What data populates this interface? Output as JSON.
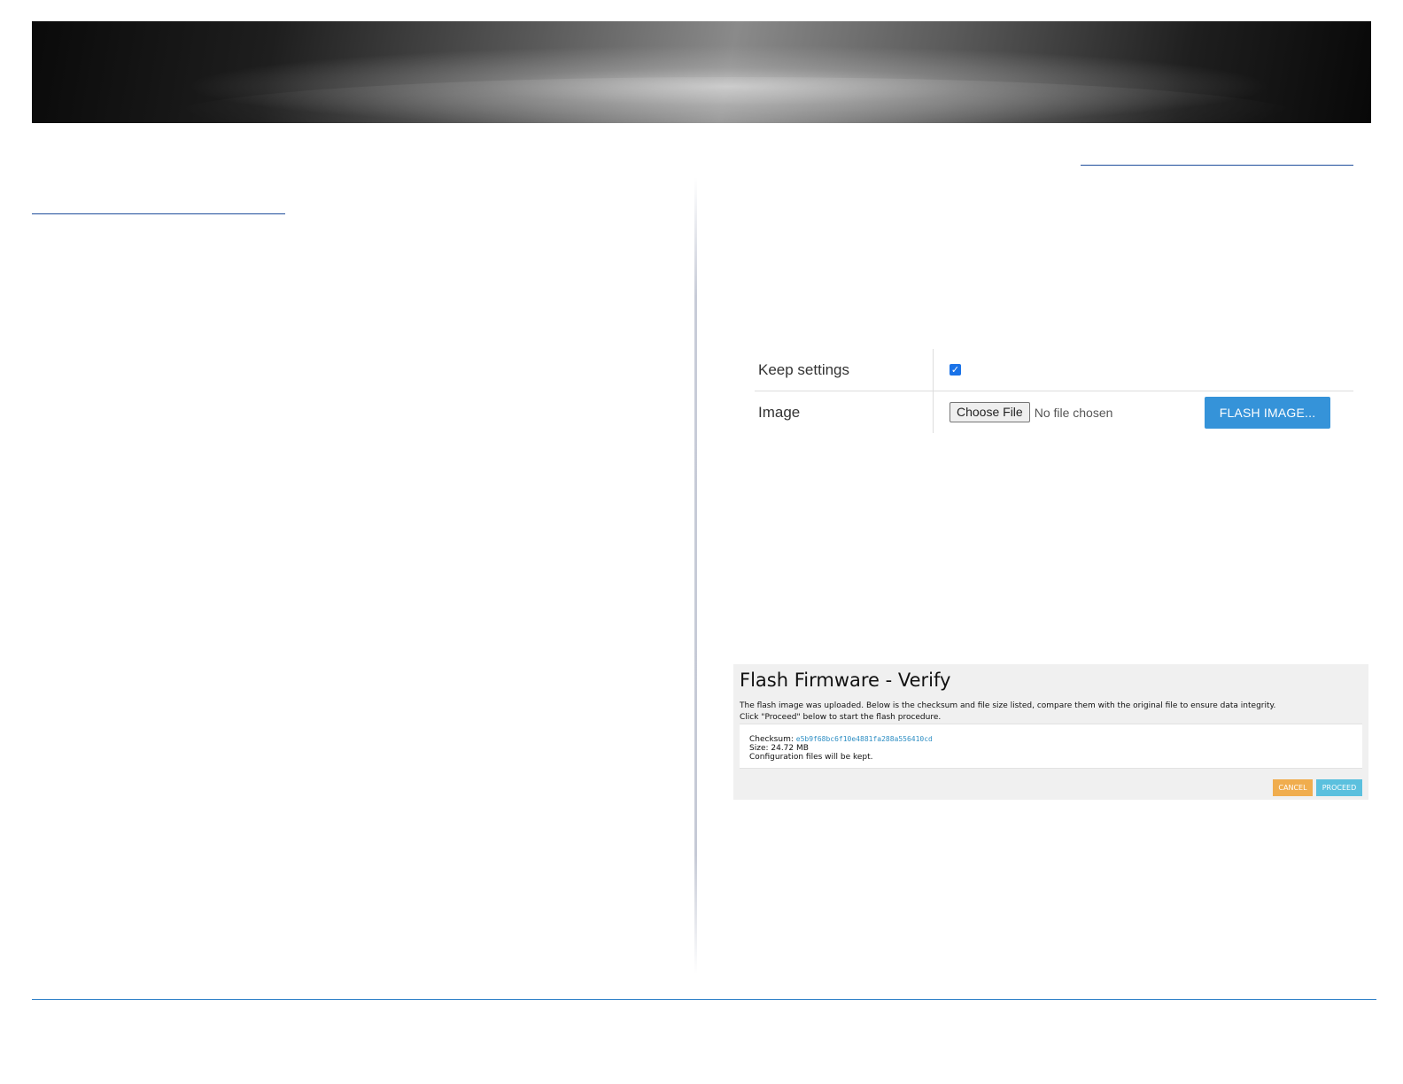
{
  "form": {
    "keep_settings_label": "Keep settings",
    "keep_settings_checked": true,
    "image_label": "Image",
    "choose_file_label": "Choose File",
    "no_file_text": "No file chosen",
    "flash_button_label": "FLASH IMAGE...",
    "flash_button_color": "#3593d9"
  },
  "verify": {
    "title": "Flash Firmware - Verify",
    "desc_line1": "The flash image was uploaded. Below is the checksum and file size listed, compare them with the original file to ensure data integrity.",
    "desc_line2": "Click \"Proceed\" below to start the flash procedure.",
    "checksum_label": "Checksum: ",
    "checksum_value": "e5b9f68bc6f10e4881fa288a556410cd",
    "size_text": "Size: 24.72 MB",
    "config_text": "Configuration files will be kept.",
    "cancel_label": "CANCEL",
    "proceed_label": "PROCEED",
    "cancel_color": "#f0ad4e",
    "proceed_color": "#5bc0de"
  }
}
